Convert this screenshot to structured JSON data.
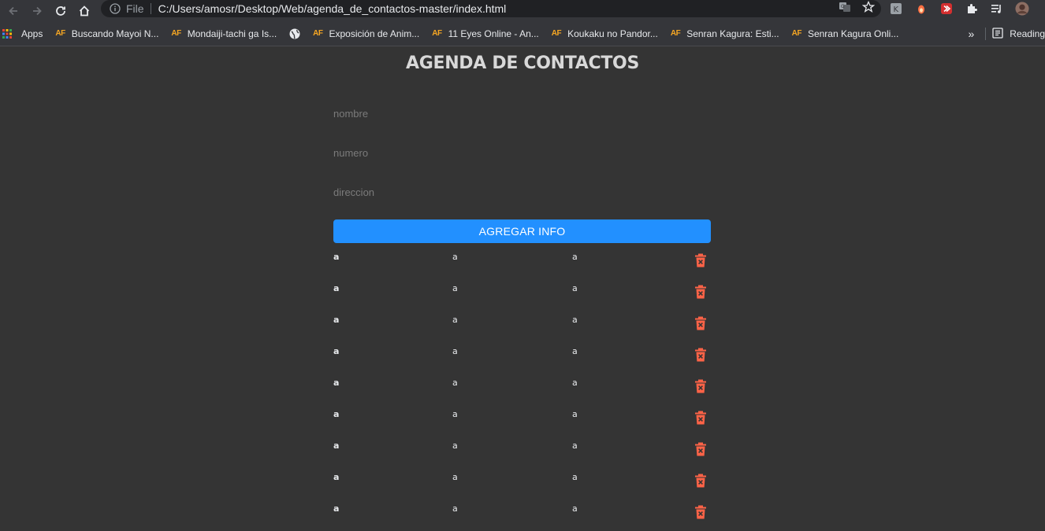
{
  "browser": {
    "scheme": "File",
    "url": "C:/Users/amosr/Desktop/Web/agenda_de_contactos-master/index.html",
    "bookmarks": [
      {
        "label": "Apps",
        "icon": "apps-grid-icon"
      },
      {
        "label": "Buscando Mayoi N...",
        "icon": "af-icon"
      },
      {
        "label": "Mondaiji-tachi ga Is...",
        "icon": "af-icon"
      },
      {
        "label": "",
        "icon": "globe-icon"
      },
      {
        "label": "Exposición de Anim...",
        "icon": "af-icon"
      },
      {
        "label": "11 Eyes Online - An...",
        "icon": "af-icon"
      },
      {
        "label": "Koukaku no Pandor...",
        "icon": "af-icon"
      },
      {
        "label": "Senran Kagura: Esti...",
        "icon": "af-icon"
      },
      {
        "label": "Senran Kagura Onli...",
        "icon": "af-icon"
      }
    ],
    "overflow": "»",
    "reading_list": "Reading",
    "af_glyph": "AF"
  },
  "page": {
    "title": "AGENDA DE CONTACTOS",
    "form": {
      "nombre_placeholder": "nombre",
      "numero_placeholder": "numero",
      "direccion_placeholder": "direccion",
      "submit_label": "AGREGAR INFO"
    },
    "contacts": [
      {
        "nombre": "a",
        "numero": "a",
        "direccion": "a"
      },
      {
        "nombre": "a",
        "numero": "a",
        "direccion": "a"
      },
      {
        "nombre": "a",
        "numero": "a",
        "direccion": "a"
      },
      {
        "nombre": "a",
        "numero": "a",
        "direccion": "a"
      },
      {
        "nombre": "a",
        "numero": "a",
        "direccion": "a"
      },
      {
        "nombre": "a",
        "numero": "a",
        "direccion": "a"
      },
      {
        "nombre": "a",
        "numero": "a",
        "direccion": "a"
      },
      {
        "nombre": "a",
        "numero": "a",
        "direccion": "a"
      },
      {
        "nombre": "a",
        "numero": "a",
        "direccion": "a"
      }
    ],
    "delete_icon": "trash-icon"
  },
  "colors": {
    "background": "#343434",
    "accent": "#2290ff",
    "delete": "#ff6347"
  }
}
